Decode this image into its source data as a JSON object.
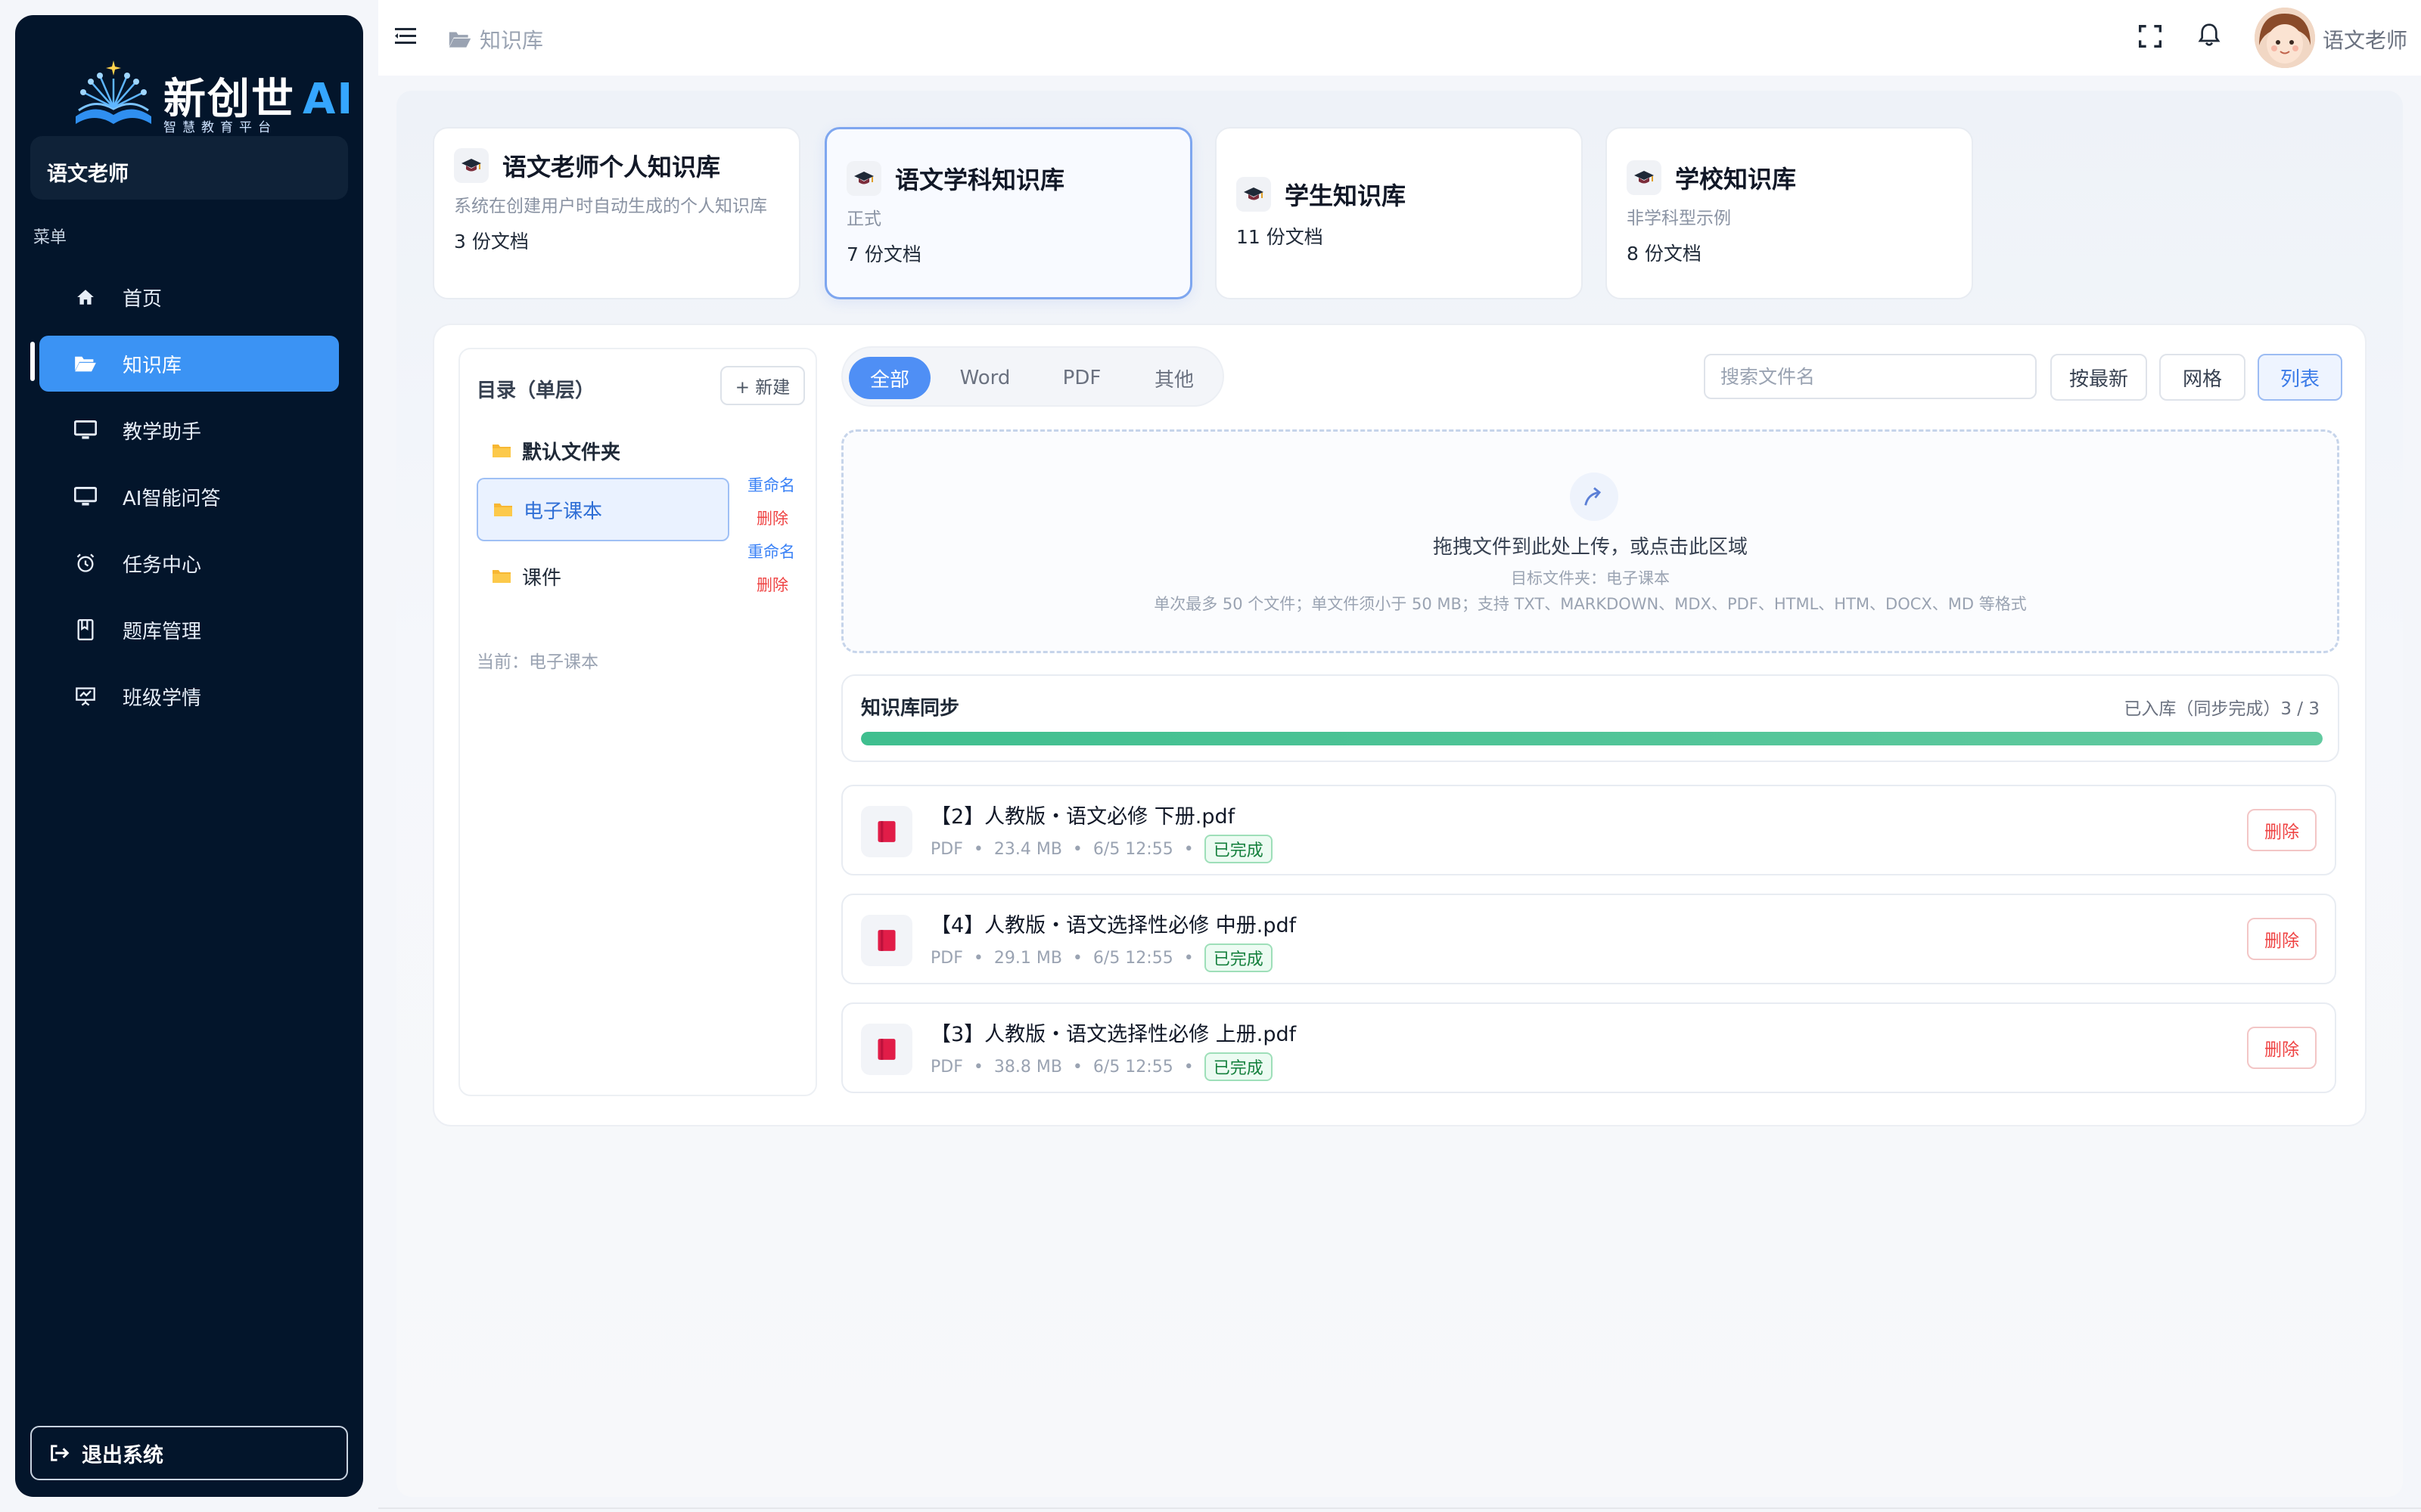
{
  "app": {
    "logo_text": "新创世",
    "logo_ai": "AI",
    "logo_subtitle": "智慧教育平台"
  },
  "sidebar": {
    "user": "语文老师",
    "menu_label": "菜单",
    "items": [
      {
        "label": "首页",
        "icon": "home-icon"
      },
      {
        "label": "知识库",
        "icon": "folder-open-icon",
        "active": true
      },
      {
        "label": "教学助手",
        "icon": "monitor-icon"
      },
      {
        "label": "AI智能问答",
        "icon": "monitor-icon"
      },
      {
        "label": "任务中心",
        "icon": "alarm-clock-icon"
      },
      {
        "label": "题库管理",
        "icon": "book-icon"
      },
      {
        "label": "班级学情",
        "icon": "presentation-icon"
      }
    ],
    "logout_label": "退出系统"
  },
  "header": {
    "breadcrumb": "知识库",
    "user_name": "语文老师"
  },
  "knowledge_bases": [
    {
      "title": "语文老师个人知识库",
      "desc": "系统在创建用户时自动生成的个人知识库",
      "count": "3 份文档"
    },
    {
      "title": "语文学科知识库",
      "desc": "正式",
      "count": "7 份文档",
      "selected": true
    },
    {
      "title": "学生知识库",
      "desc": "",
      "count": "11 份文档"
    },
    {
      "title": "学校知识库",
      "desc": "非学科型示例",
      "count": "8 份文档"
    }
  ],
  "directory": {
    "title": "目录（单层）",
    "new_button": "+ 新建",
    "folders": [
      {
        "name": "默认文件夹"
      },
      {
        "name": "电子课本",
        "active": true,
        "rename": "重命名",
        "delete": "删除"
      },
      {
        "name": "课件",
        "rename": "重命名",
        "delete": "删除"
      }
    ],
    "current": "当前：电子课本"
  },
  "filters": {
    "tabs": [
      "全部",
      "Word",
      "PDF",
      "其他"
    ],
    "active_tab": "全部",
    "search_placeholder": "搜索文件名",
    "sort_button": "按最新",
    "grid_button": "网格",
    "list_button": "列表"
  },
  "upload": {
    "main_text": "拖拽文件到此处上传，或点击此区域",
    "target_text": "目标文件夹：电子课本",
    "hint_text": "单次最多 50 个文件；单文件须小于 50 MB；支持 TXT、MARKDOWN、MDX、PDF、HTML、HTM、DOCX、MD 等格式"
  },
  "sync": {
    "title": "知识库同步",
    "status": "已入库（同步完成）3 / 3",
    "progress": 1.0,
    "color": "#3fbf8f"
  },
  "files": [
    {
      "name": "【2】人教版・语文必修 下册.pdf",
      "type": "PDF",
      "size": "23.4 MB",
      "date": "6/5 12:55",
      "status": "已完成",
      "delete": "删除"
    },
    {
      "name": "【4】人教版・语文选择性必修 中册.pdf",
      "type": "PDF",
      "size": "29.1 MB",
      "date": "6/5 12:55",
      "status": "已完成",
      "delete": "删除"
    },
    {
      "name": "【3】人教版・语文选择性必修 上册.pdf",
      "type": "PDF",
      "size": "38.8 MB",
      "date": "6/5 12:55",
      "status": "已完成",
      "delete": "删除"
    }
  ],
  "colors": {
    "sidebar_bg": "#03152b",
    "accent": "#3b93f4",
    "danger": "#ef4444",
    "success": "#15803d"
  }
}
